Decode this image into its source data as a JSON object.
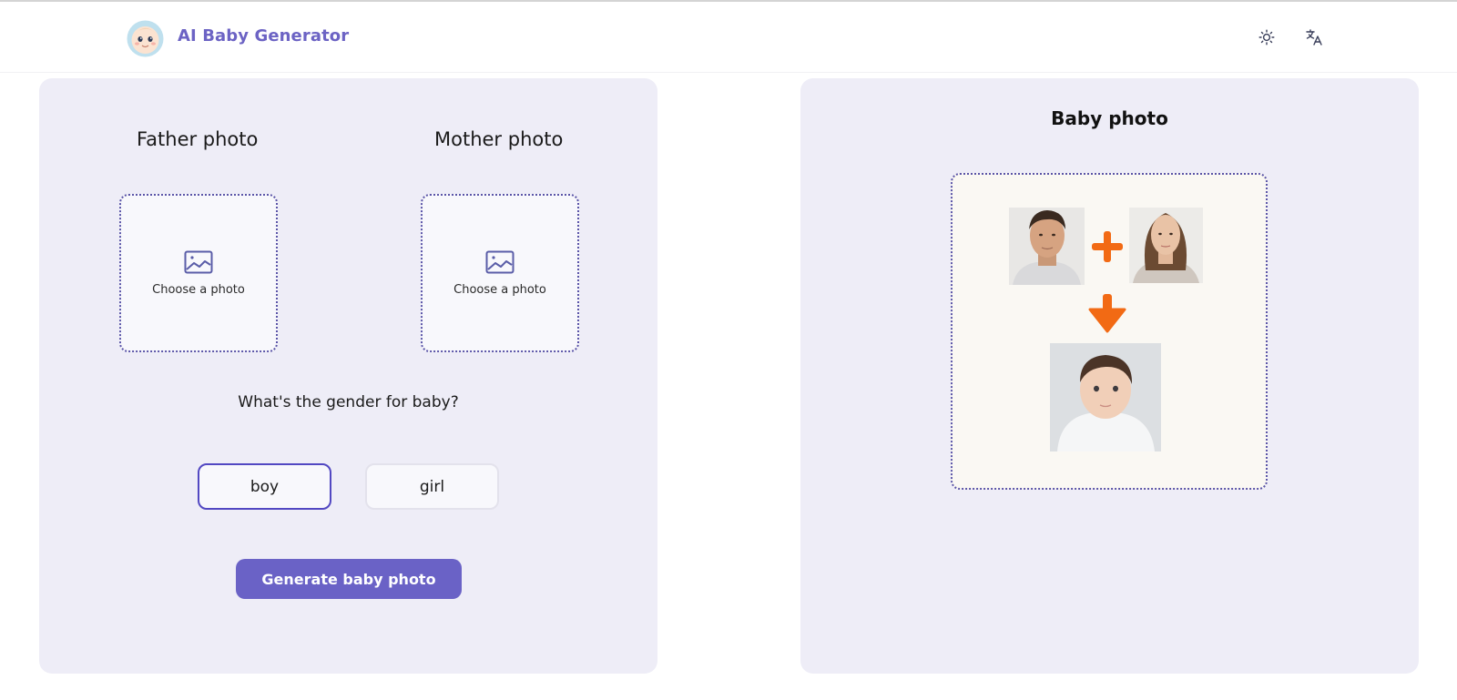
{
  "app": {
    "title": "AI Baby Generator"
  },
  "header": {
    "theme_icon": "sun-icon",
    "language_icon": "translate-icon"
  },
  "left_panel": {
    "father_title": "Father photo",
    "mother_title": "Mother photo",
    "upload_label": "Choose a photo",
    "gender_question": "What's the gender for baby?",
    "gender_options": [
      {
        "label": "boy",
        "selected": true
      },
      {
        "label": "girl",
        "selected": false
      }
    ],
    "generate_label": "Generate baby photo"
  },
  "right_panel": {
    "title": "Baby photo"
  },
  "colors": {
    "accent": "#6a62c6",
    "panel_bg": "#eeedf7",
    "arrow_orange": "#f26a14",
    "selected_border": "#5248c2"
  }
}
